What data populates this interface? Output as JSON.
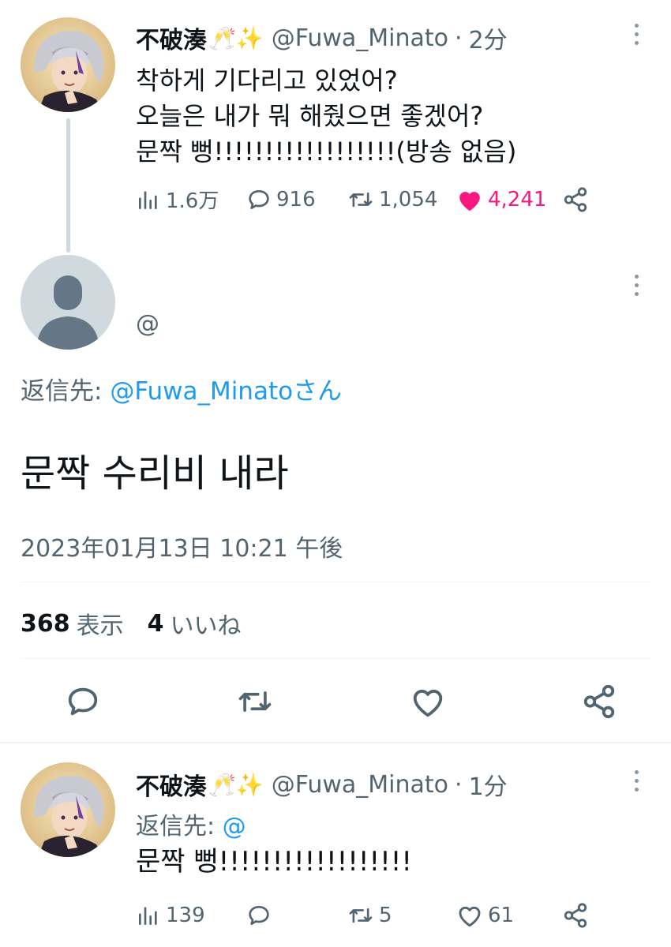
{
  "tweet1": {
    "display_name": "不破湊",
    "emoji": "🥂✨",
    "handle": "@Fuwa_Minato",
    "time": "2分",
    "text": "착하게 기다리고 있었어?\n오늘은 내가 뭐 해줬으면 좋겠어?\n문짝 뻥!!!!!!!!!!!!!!!!!!(방송 없음)",
    "views": "1.6万",
    "replies": "916",
    "retweets": "1,054",
    "likes": "4,241",
    "liked": true
  },
  "focused": {
    "handle": "@",
    "reply_to_prefix": "返信先: ",
    "reply_to_mention": "@Fuwa_Minatoさん",
    "text": "문짝 수리비 내라",
    "timestamp": "2023年01月13日 10:21 午後",
    "views_count": "368",
    "views_label": "表示",
    "likes_count": "4",
    "likes_label": "いいね"
  },
  "tweet3": {
    "display_name": "不破湊",
    "emoji": "🥂✨",
    "handle": "@Fuwa_Minato",
    "time": "1分",
    "reply_to_prefix": "返信先: ",
    "reply_to_mention": "@",
    "text": "문짝 뻥!!!!!!!!!!!!!!!!!!",
    "views": "139",
    "replies": "",
    "retweets": "5",
    "likes": "61"
  },
  "colors": {
    "accent": "#1d9bf0",
    "like": "#f91880",
    "secondary_text": "#536471",
    "divider": "#eff3f4"
  },
  "icons": [
    "views-icon",
    "reply-icon",
    "retweet-icon",
    "like-icon",
    "share-icon",
    "more-icon",
    "default-avatar-icon"
  ]
}
